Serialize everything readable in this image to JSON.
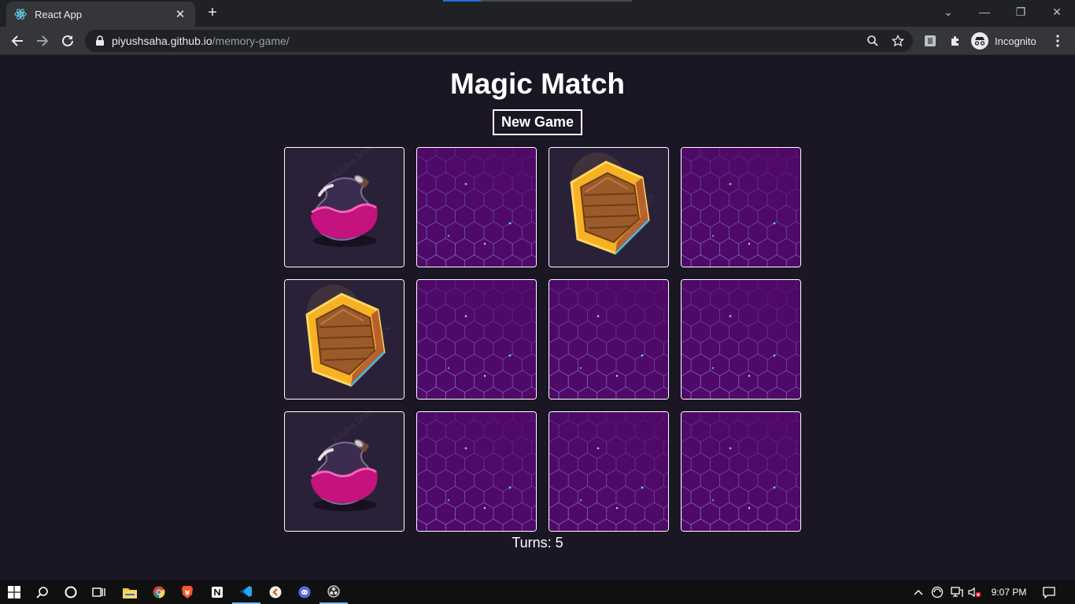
{
  "browser": {
    "tab_title": "React App",
    "new_tab_label": "+",
    "url_host": "piyushsaha.github.io",
    "url_path": "/memory-game/",
    "profile_label": "Incognito"
  },
  "game": {
    "title": "Magic Match",
    "new_game_label": "New Game",
    "turns_label": "Turns: 5",
    "cards": [
      {
        "face": "potion"
      },
      {
        "face": "back"
      },
      {
        "face": "shield"
      },
      {
        "face": "back"
      },
      {
        "face": "shield"
      },
      {
        "face": "back"
      },
      {
        "face": "back"
      },
      {
        "face": "back"
      },
      {
        "face": "potion"
      },
      {
        "face": "back"
      },
      {
        "face": "back"
      },
      {
        "face": "back"
      }
    ]
  },
  "taskbar": {
    "clock": "9:07 PM",
    "apps": [
      "windows-start-icon",
      "search-icon",
      "cortana-icon",
      "task-view-icon",
      "file-explorer-icon",
      "chrome-icon",
      "brave-icon",
      "notion-icon",
      "vscode-icon",
      "app-icon",
      "discord-icon",
      "obs-icon"
    ]
  },
  "colors": {
    "page_bg": "#1b1624",
    "card_back": "#4e0a66",
    "card_front_bg": "#2a2038",
    "border": "#ffffff"
  }
}
